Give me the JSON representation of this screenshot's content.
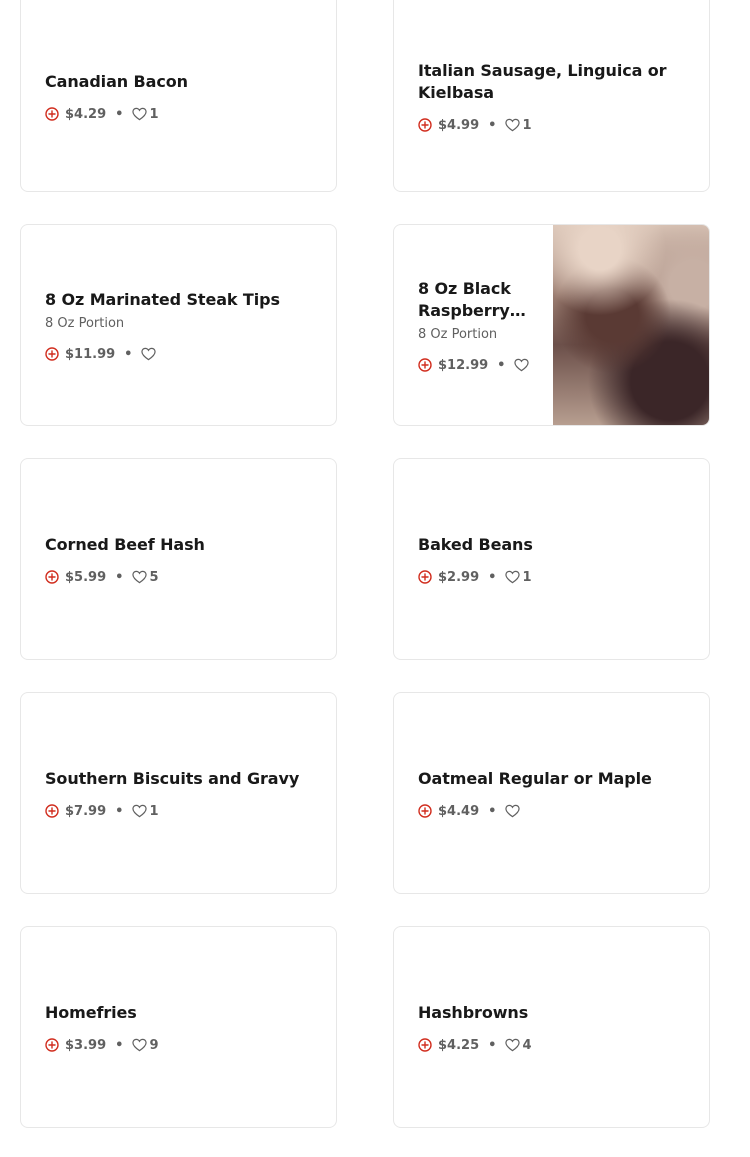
{
  "colors": {
    "accent": "#d12d1e",
    "text": "#191919",
    "muted": "#606060",
    "border": "#e7e7e7"
  },
  "items": [
    {
      "name": "Canadian Bacon",
      "description": "",
      "price": "$4.29",
      "likes": "1"
    },
    {
      "name": "Italian Sausage, Linguica or Kielbasa",
      "description": "",
      "price": "$4.99",
      "likes": "1"
    },
    {
      "name": "8 Oz Marinated Steak Tips",
      "description": "8 Oz Portion",
      "price": "$11.99",
      "likes": ""
    },
    {
      "name": "8 Oz Black Raspberry…",
      "description": "8 Oz Portion",
      "price": "$12.99",
      "likes": ""
    },
    {
      "name": "Corned Beef Hash",
      "description": "",
      "price": "$5.99",
      "likes": "5"
    },
    {
      "name": "Baked Beans",
      "description": "",
      "price": "$2.99",
      "likes": "1"
    },
    {
      "name": "Southern Biscuits and Gravy",
      "description": "",
      "price": "$7.99",
      "likes": "1"
    },
    {
      "name": "Oatmeal Regular or Maple",
      "description": "",
      "price": "$4.49",
      "likes": ""
    },
    {
      "name": "Homefries",
      "description": "",
      "price": "$3.99",
      "likes": "9"
    },
    {
      "name": "Hashbrowns",
      "description": "",
      "price": "$4.25",
      "likes": "4"
    }
  ],
  "separator": "•"
}
